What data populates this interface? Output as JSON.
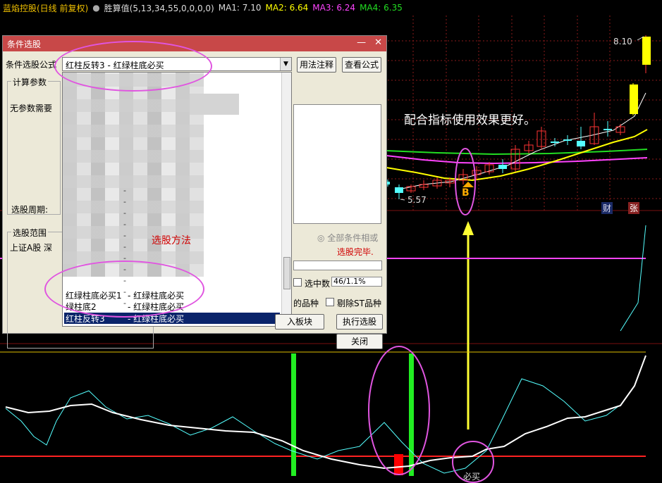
{
  "header": {
    "title": "蓝焰控股(日线 前复权)",
    "indicator": "胜算值(5,13,34,55,0,0,0,0)",
    "ma1": "MA1: 7.10",
    "ma2": "MA2: 6.64",
    "ma3": "MA3: 6.24",
    "ma4": "MA4: 6.35"
  },
  "chart": {
    "price_high": "8.10",
    "price_low": "5.57",
    "promo_text": "配合指标使用效果更好。",
    "tag_cai": "财",
    "tag_zhang": "张",
    "b_mark": "B",
    "bottom_label": "必买",
    "colors": {
      "up": "#ff3333",
      "down": "#54ffff",
      "ma_yellow": "#ffff00",
      "ma_magenta": "#ff44ff",
      "ma_green": "#22dd22",
      "arrow": "#ffff33",
      "ellipse": "#e055e0"
    }
  },
  "dialog": {
    "title": "条件选股",
    "formula_label": "条件选股公式",
    "formula_value": "红柱反转3    -  红绿柱底必买",
    "usage_button": "用法注释",
    "view_formula_button": "查看公式",
    "params_group": "计算参数",
    "no_params": "无参数需要",
    "period_label": "选股周期:",
    "range_group": "选股范围",
    "range_value": "上证A股  深",
    "method_label": "选股方法",
    "list_items": [
      {
        "name": "红绿柱底必买1",
        "desc": "- 红绿柱底必买"
      },
      {
        "name": "绿柱底2",
        "desc": "- 红绿柱底必买"
      },
      {
        "name": "红柱反转3",
        "desc": "- 红绿柱底必买"
      }
    ],
    "all_conditions": "全部条件相或",
    "status": "选股完毕.",
    "selected_count_label": "选中数",
    "selected_count_value": "46/1.1%",
    "include_label": "的品种",
    "exclude_st": "剔除ST品种",
    "add_to_block": "入板块",
    "execute_button": "执行选股",
    "close_button": "关闭"
  }
}
